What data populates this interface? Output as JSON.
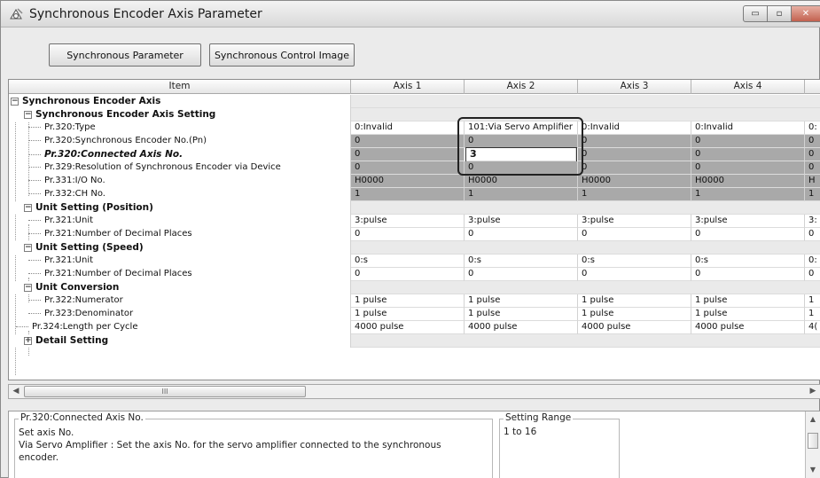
{
  "window": {
    "title": "Synchronous Encoder Axis Parameter"
  },
  "toolbar": {
    "sync_param_label": "Synchronous Parameter",
    "sync_image_label": "Synchronous Control Image"
  },
  "grid": {
    "headers": {
      "item": "Item",
      "axis1": "Axis 1",
      "axis2": "Axis 2",
      "axis3": "Axis 3",
      "axis4": "Axis 4"
    },
    "rows": [
      {
        "label": "Synchronous Encoder Axis",
        "v1": "",
        "v2": "",
        "v3": "",
        "v4": "",
        "v5": ""
      },
      {
        "label": "Synchronous Encoder Axis Setting",
        "v1": "",
        "v2": "",
        "v3": "",
        "v4": "",
        "v5": ""
      },
      {
        "label": "Pr.320:Type",
        "v1": "0:Invalid",
        "v2": "101:Via Servo Amplifier",
        "v3": "0:Invalid",
        "v4": "0:Invalid",
        "v5": "0:"
      },
      {
        "label": "Pr.320:Synchronous Encoder No.(Pn)",
        "v1": "0",
        "v2": "0",
        "v3": "0",
        "v4": "0",
        "v5": "0"
      },
      {
        "label": "Pr.320:Connected Axis No.",
        "v1": "0",
        "v2": "3",
        "v3": "0",
        "v4": "0",
        "v5": "0"
      },
      {
        "label": "Pr.329:Resolution of Synchronous Encoder via Device",
        "v1": "0",
        "v2": "0",
        "v3": "0",
        "v4": "0",
        "v5": "0"
      },
      {
        "label": "Pr.331:I/O No.",
        "v1": "H0000",
        "v2": "H0000",
        "v3": "H0000",
        "v4": "H0000",
        "v5": "H"
      },
      {
        "label": "Pr.332:CH No.",
        "v1": "1",
        "v2": "1",
        "v3": "1",
        "v4": "1",
        "v5": "1"
      },
      {
        "label": "Unit Setting (Position)",
        "v1": "",
        "v2": "",
        "v3": "",
        "v4": "",
        "v5": ""
      },
      {
        "label": "Pr.321:Unit",
        "v1": "3:pulse",
        "v2": "3:pulse",
        "v3": "3:pulse",
        "v4": "3:pulse",
        "v5": "3:"
      },
      {
        "label": "Pr.321:Number of Decimal Places",
        "v1": "0",
        "v2": "0",
        "v3": "0",
        "v4": "0",
        "v5": "0"
      },
      {
        "label": "Unit Setting (Speed)",
        "v1": "",
        "v2": "",
        "v3": "",
        "v4": "",
        "v5": ""
      },
      {
        "label": "Pr.321:Unit",
        "v1": "0:s",
        "v2": "0:s",
        "v3": "0:s",
        "v4": "0:s",
        "v5": "0:"
      },
      {
        "label": "Pr.321:Number of Decimal Places",
        "v1": "0",
        "v2": "0",
        "v3": "0",
        "v4": "0",
        "v5": "0"
      },
      {
        "label": "Unit Conversion",
        "v1": "",
        "v2": "",
        "v3": "",
        "v4": "",
        "v5": ""
      },
      {
        "label": "Pr.322:Numerator",
        "v1": "1 pulse",
        "v2": "1 pulse",
        "v3": "1 pulse",
        "v4": "1 pulse",
        "v5": "1"
      },
      {
        "label": "Pr.323:Denominator",
        "v1": "1 pulse",
        "v2": "1 pulse",
        "v3": "1 pulse",
        "v4": "1 pulse",
        "v5": "1"
      },
      {
        "label": "Pr.324:Length per Cycle",
        "v1": "4000 pulse",
        "v2": "4000 pulse",
        "v3": "4000 pulse",
        "v4": "4000 pulse",
        "v5": "4("
      },
      {
        "label": "Detail Setting",
        "v1": "",
        "v2": "",
        "v3": "",
        "v4": "",
        "v5": ""
      }
    ]
  },
  "description": {
    "legend": "Pr.320:Connected Axis No.",
    "line1": "Set axis No.",
    "line2": "Via Servo Amplifier : Set the axis No. for the servo amplifier connected to the synchronous",
    "line3": "encoder."
  },
  "setting_range": {
    "legend": "Setting Range",
    "value": "1 to 16"
  },
  "scroll": {
    "thumb_grip": "III"
  },
  "glyphs": {
    "collapse": "−",
    "expand": "+",
    "minimize": "▭",
    "maximize": "▫",
    "close": "✕",
    "left": "◀",
    "right": "▶",
    "up": "▲",
    "down": "▼"
  },
  "colors": {
    "gray_row": "#a9a9a9",
    "group_bg": "#eaeaea"
  }
}
